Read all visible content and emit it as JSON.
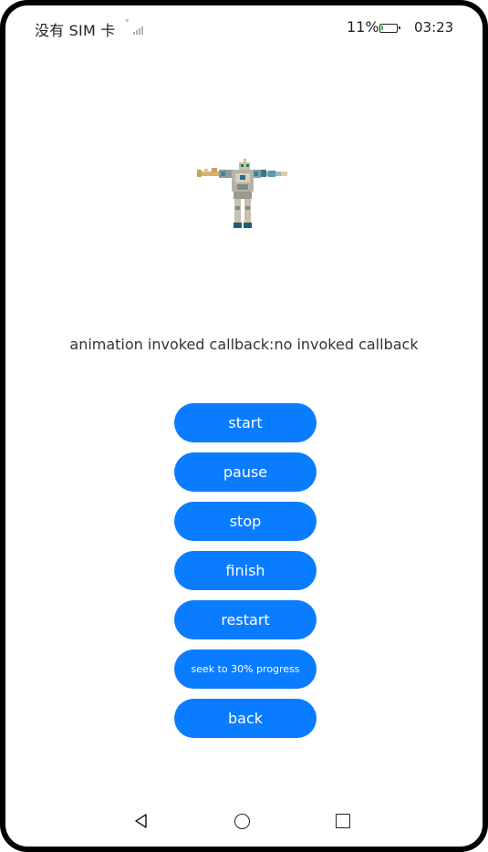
{
  "status_bar": {
    "carrier": "没有 SIM 卡",
    "signal_marker": "*",
    "battery_percent": "11%",
    "battery_level": 0.11,
    "time": "03:23"
  },
  "figure": {
    "icon": "robot-model-icon"
  },
  "callback": {
    "text": "animation invoked callback:no invoked callback"
  },
  "buttons": {
    "start": "start",
    "pause": "pause",
    "stop": "stop",
    "finish": "finish",
    "restart": "restart",
    "seek": "seek to 30% progress",
    "back": "back"
  },
  "nav_bar": {
    "back_icon": "back-triangle-icon",
    "home_icon": "home-circle-icon",
    "recent_icon": "recent-square-icon"
  },
  "colors": {
    "accent": "#0a7cff",
    "text": "#333333",
    "background": "#ffffff"
  }
}
